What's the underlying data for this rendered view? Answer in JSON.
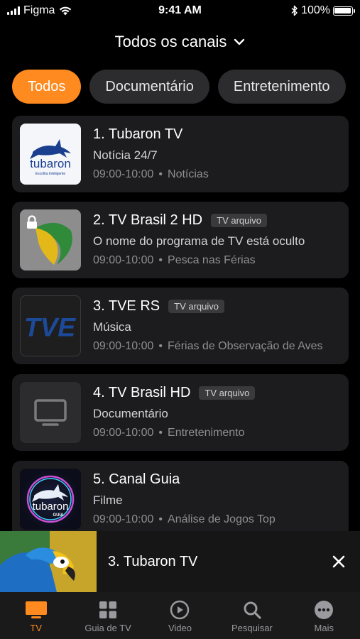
{
  "status_bar": {
    "carrier": "Figma",
    "time": "9:41 AM",
    "battery": "100%"
  },
  "header": {
    "title": "Todos os canais",
    "dropdown_icon": "chevron-down-icon"
  },
  "filters": [
    {
      "label": "Todos",
      "active": true
    },
    {
      "label": "Documentário",
      "active": false
    },
    {
      "label": "Entretenimento",
      "active": false
    }
  ],
  "channels": [
    {
      "name": "1. Tubaron TV",
      "badge": "",
      "program": "Notícia 24/7",
      "time": "09:00-10:00",
      "category": "Notícias",
      "thumb": "tubaron-logo",
      "locked": false
    },
    {
      "name": "2. TV Brasil 2 HD",
      "badge": "TV arquivo",
      "program": "O nome do programa de TV está oculto",
      "time": "09:00-10:00",
      "category": "Pesca nas Férias",
      "thumb": "tv-brasil-logo",
      "locked": true
    },
    {
      "name": "3. TVE RS",
      "badge": "TV arquivo",
      "program": "Música",
      "time": "09:00-10:00",
      "category": "Férias de Observação de Aves",
      "thumb": "tve-logo",
      "locked": false
    },
    {
      "name": "4. TV Brasil HD",
      "badge": "TV arquivo",
      "program": "Documentário",
      "time": "09:00-10:00",
      "category": "Entretenimento",
      "thumb": "tv-placeholder-icon",
      "locked": false
    },
    {
      "name": "5. Canal Guia",
      "badge": "",
      "program": "Filme",
      "time": "09:00-10:00",
      "category": "Análise de Jogos Top",
      "thumb": "canal-guia-logo",
      "locked": false
    }
  ],
  "mini_player": {
    "title": "3. Tubaron TV",
    "close_icon": "close-icon"
  },
  "tabs": [
    {
      "label": "TV",
      "icon": "tv-icon",
      "active": true
    },
    {
      "label": "Guia de TV",
      "icon": "grid-icon",
      "active": false
    },
    {
      "label": "Video",
      "icon": "play-circle-icon",
      "active": false
    },
    {
      "label": "Pesquisar",
      "icon": "search-icon",
      "active": false
    },
    {
      "label": "Mais",
      "icon": "more-icon",
      "active": false
    }
  ],
  "colors": {
    "accent": "#ff8a1f",
    "background": "#000000",
    "card": "#1c1c1e"
  }
}
